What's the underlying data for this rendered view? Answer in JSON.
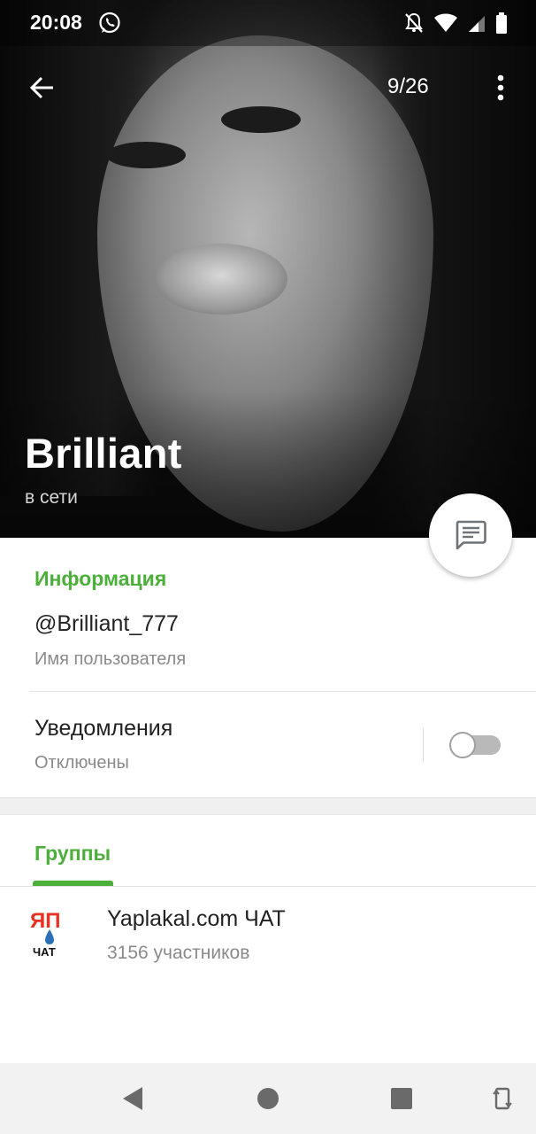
{
  "status_bar": {
    "time": "20:08",
    "icons": [
      "whatsapp-icon",
      "notifications-off-icon",
      "wifi-icon",
      "signal-icon",
      "battery-icon"
    ]
  },
  "toolbar": {
    "back_icon": "arrow-back-icon",
    "photo_counter": "9/26",
    "menu_icon": "more-vert-icon"
  },
  "profile": {
    "name": "Brilliant",
    "status": "в сети"
  },
  "fab": {
    "icon": "message-icon"
  },
  "info": {
    "title": "Информация",
    "username_value": "@Brilliant_777",
    "username_label": "Имя пользователя",
    "notifications_title": "Уведомления",
    "notifications_status": "Отключены",
    "notifications_enabled": false
  },
  "groups": {
    "title": "Группы",
    "items": [
      {
        "name": "Yaplakal.com ЧАТ",
        "members": "3156 участников",
        "logo_text_top": "ЯП",
        "logo_text_bottom": "ЧАТ"
      }
    ]
  },
  "nav_bar": {
    "buttons": [
      "back-triangle-icon",
      "home-circle-icon",
      "recents-square-icon",
      "rotate-icon"
    ]
  },
  "colors": {
    "accent": "#4caf3a",
    "text_primary": "#222222",
    "text_secondary": "#8a8a8a",
    "navbar_bg": "#f2f2f2",
    "logo_red": "#e53222",
    "logo_blue": "#2a6fb8"
  }
}
